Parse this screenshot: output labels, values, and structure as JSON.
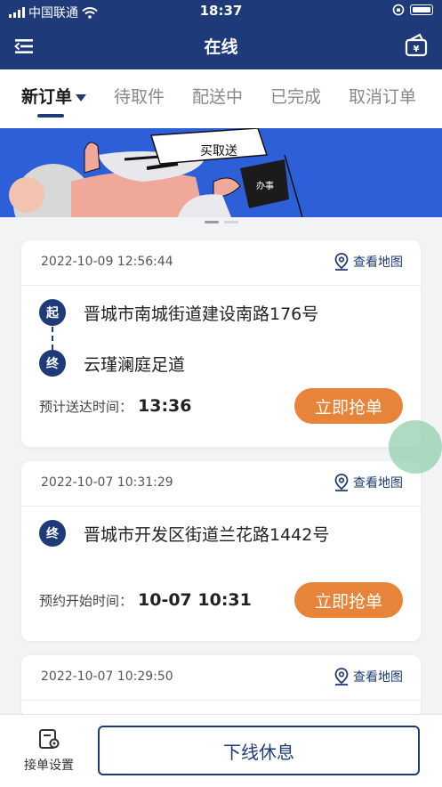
{
  "status_bar": {
    "carrier": "中国联通",
    "time": "18:37"
  },
  "navbar": {
    "title": "在线"
  },
  "tabs": [
    {
      "label": "新订单",
      "active": true
    },
    {
      "label": "待取件",
      "active": false
    },
    {
      "label": "配送中",
      "active": false
    },
    {
      "label": "已完成",
      "active": false
    },
    {
      "label": "取消订单",
      "active": false
    }
  ],
  "banner": {
    "sign_text": "买取送",
    "flag_text": "办事"
  },
  "orders": [
    {
      "created": "2022-10-09 12:56:44",
      "map_label": "查看地图",
      "start_badge": "起",
      "start_address": "晋城市南城街道建设南路176号",
      "end_badge": "终",
      "end_address": "云瑾澜庭足道",
      "time_label": "预计送达时间：",
      "time_value": "13:36",
      "grab_label": "立即抢单"
    },
    {
      "created": "2022-10-07 10:31:29",
      "map_label": "查看地图",
      "end_badge": "终",
      "end_address": "晋城市开发区街道兰花路1442号",
      "time_label": "预约开始时间：",
      "time_value": "10-07 10:31",
      "grab_label": "立即抢单"
    },
    {
      "created": "2022-10-07 10:29:50",
      "map_label": "查看地图"
    }
  ],
  "bottom": {
    "settings_label": "接单设置",
    "offline_label": "下线休息"
  },
  "colors": {
    "primary": "#1e3a78",
    "accent": "#e8843a",
    "banner": "#2d60d8",
    "background": "#f2f3f5"
  }
}
